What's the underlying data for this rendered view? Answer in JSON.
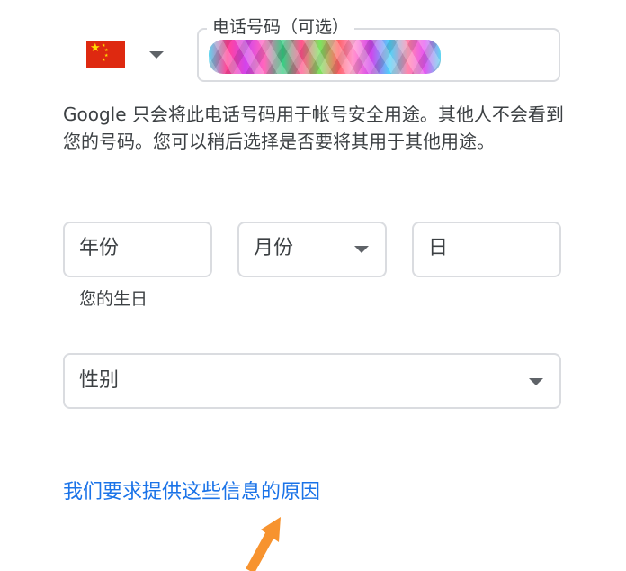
{
  "phone": {
    "country_flag": "china-flag-icon",
    "label": "电话号码（可选）",
    "value_redacted": true
  },
  "phone_help_text": "Google 只会将此电话号码用于帐号安全用途。其他人不会看到您的号码。您可以稍后选择是否要将其用于其他用途。",
  "birthday": {
    "year_placeholder": "年份",
    "month_placeholder": "月份",
    "day_placeholder": "日",
    "caption": "您的生日"
  },
  "gender": {
    "placeholder": "性别"
  },
  "why_link": "我们要求提供这些信息的原因",
  "colors": {
    "link": "#1a73e8",
    "border": "#dadce0",
    "annotation_arrow": "#f7932f"
  }
}
